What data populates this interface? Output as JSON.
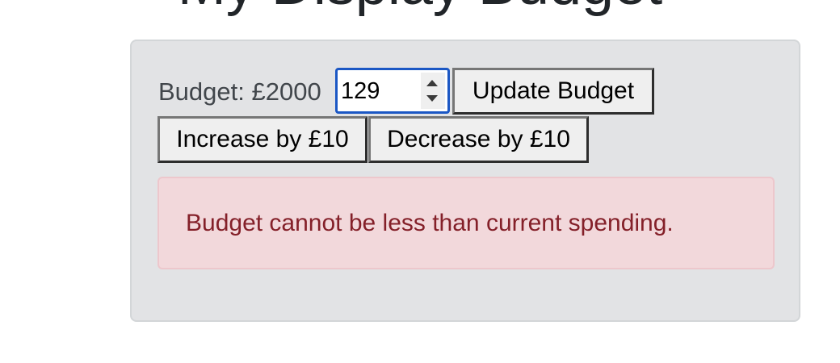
{
  "header": {
    "title": "My Display Budget"
  },
  "budget": {
    "label": "Budget: £2000",
    "input_value": "129",
    "update_label": "Update Budget",
    "increase_label": "Increase by £10",
    "decrease_label": "Decrease by £10"
  },
  "alert": {
    "message": "Budget cannot be less than current spending."
  },
  "colors": {
    "card_background": "#e2e3e5",
    "alert_background": "#f2d8db",
    "alert_text": "#842029",
    "input_focus_border": "#1b57c4"
  }
}
